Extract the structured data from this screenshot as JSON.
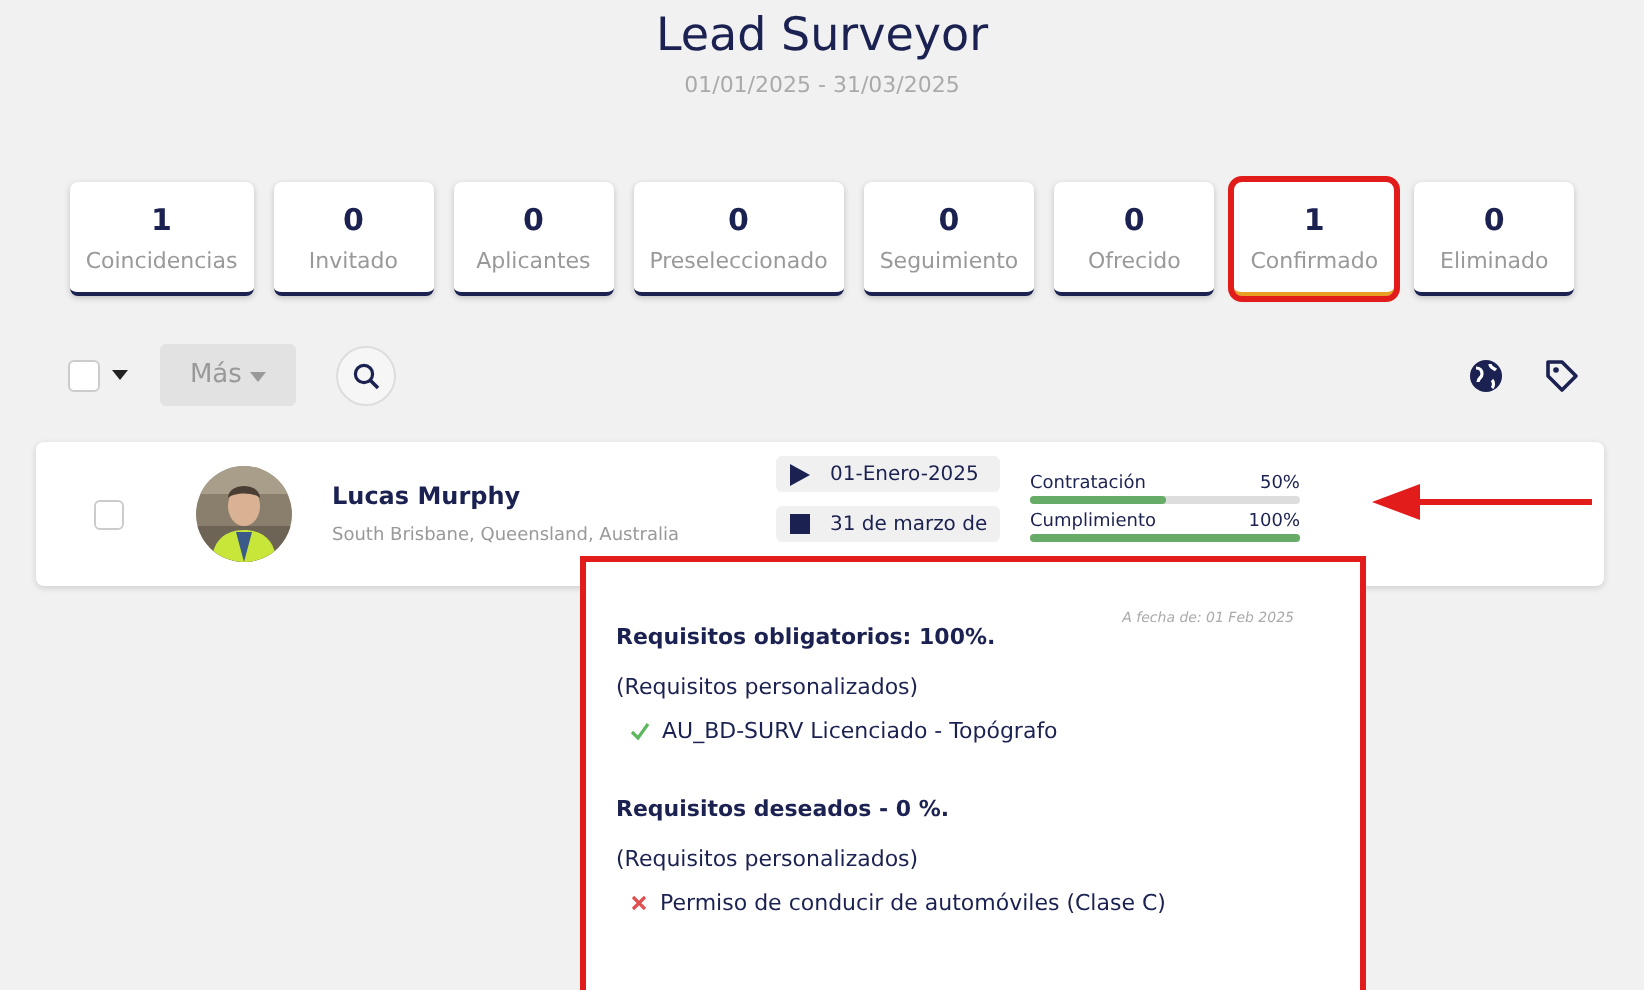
{
  "header": {
    "title": "Lead Surveyor",
    "date_range": "01/01/2025 - 31/03/2025"
  },
  "stages": [
    {
      "count": "1",
      "label": "Coincidencias",
      "selected": false
    },
    {
      "count": "0",
      "label": "Invitado",
      "selected": false
    },
    {
      "count": "0",
      "label": "Aplicantes",
      "selected": false
    },
    {
      "count": "0",
      "label": "Preseleccionado",
      "selected": false
    },
    {
      "count": "0",
      "label": "Seguimiento",
      "selected": false
    },
    {
      "count": "0",
      "label": "Ofrecido",
      "selected": false
    },
    {
      "count": "1",
      "label": "Confirmado",
      "selected": true
    },
    {
      "count": "0",
      "label": "Eliminado",
      "selected": false
    }
  ],
  "toolbar": {
    "select_all_checked": false,
    "more_button": "Más"
  },
  "candidate": {
    "name": "Lucas Murphy",
    "location": "South Brisbane, Queensland, Australia",
    "checked": false,
    "start_date": "01-Enero-2025",
    "end_date": "31 de marzo de",
    "progress": [
      {
        "label": "Contratación",
        "reading": "50%",
        "level": 0.5
      },
      {
        "label": "Cumplimiento",
        "reading": "100%",
        "level": 1
      }
    ]
  },
  "popup": {
    "as_of": "A fecha de: 01 Feb 2025",
    "sections": [
      {
        "heading": "Requisitos obligatorios: 100%.",
        "group": "(Requisitos personalizados)",
        "items": [
          {
            "text": "AU_BD-SURV Licenciado - Topógrafo",
            "met": true
          }
        ]
      },
      {
        "heading": "Requisitos deseados - 0 %.",
        "group": "(Requisitos personalizados)",
        "items": [
          {
            "text": "Permiso de conducir de automóviles (Clase C)",
            "met": false
          }
        ]
      }
    ]
  }
}
